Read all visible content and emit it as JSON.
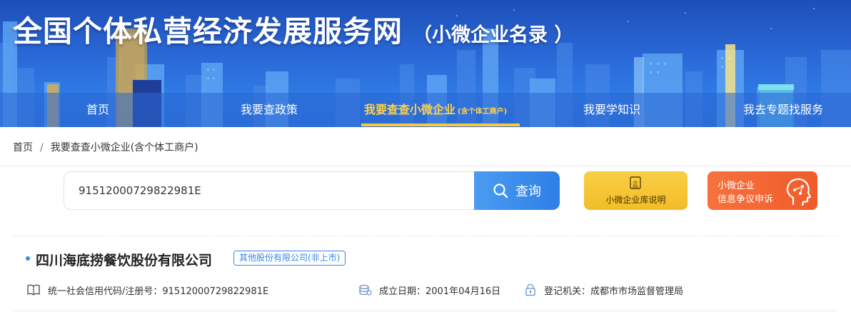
{
  "header": {
    "site_title": "全国个体私营经济发展服务网",
    "site_subtitle": "（小微企业名录 ）"
  },
  "nav": {
    "items": [
      {
        "label": "首页"
      },
      {
        "label": "我要查政策"
      },
      {
        "label": "我要查查小微企业",
        "suffix": "(含个体工商户)",
        "active": true
      },
      {
        "label": "我要学知识"
      },
      {
        "label": "我去专题找服务"
      }
    ]
  },
  "breadcrumb": {
    "home": "首页",
    "separator": "/",
    "current": "我要查查小微企业(含个体工商户)"
  },
  "search": {
    "value": "91512000729822981E",
    "button_label": "查询"
  },
  "actions": {
    "library_info_label": "小微企业库说明",
    "dispute_line1": "小微企业",
    "dispute_line2": "信息争议申诉"
  },
  "result": {
    "company_name": "四川海底捞餐饮股份有限公司",
    "company_type": "其他股份有限公司(非上市)",
    "credit_code": "统一社会信用代码/注册号：91512000729822981E",
    "established": "成立日期：2001年04月16日",
    "registry": "登记机关：成都市市场监督管理局"
  },
  "colors": {
    "banner_blue": "#2a69d8",
    "nav_active": "#ffd24a",
    "search_button": "#2e7fe6",
    "info_button": "#f2bd27",
    "dispute_button": "#f15b2a",
    "tag_blue": "#3a86e8"
  }
}
